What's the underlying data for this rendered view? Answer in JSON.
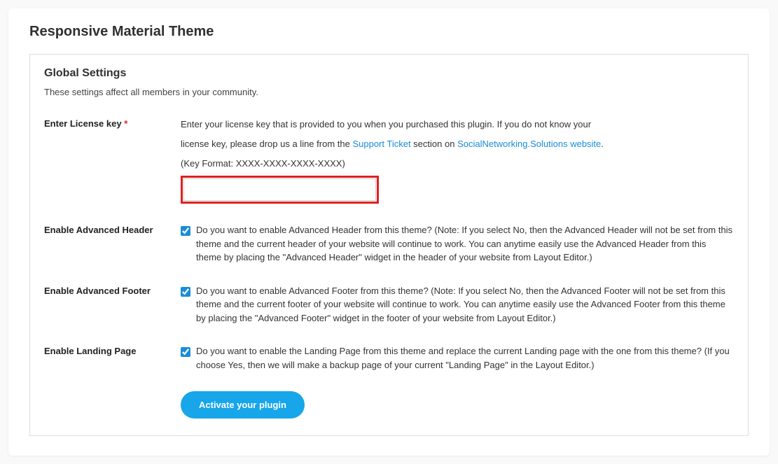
{
  "page_title": "Responsive Material Theme",
  "section": {
    "title": "Global Settings",
    "subtitle": "These settings affect all members in your community."
  },
  "license": {
    "label": "Enter License key",
    "required_mark": "*",
    "help_pre": "Enter your license key that is provided to you when you purchased this plugin. If you do not know your",
    "help_line2a": "license key, please drop us a line from the ",
    "help_link1": "Support Ticket",
    "help_line2b": " section on ",
    "help_link2": "SocialNetworking.Solutions website",
    "help_line2c": ".",
    "format": "(Key Format: XXXX-XXXX-XXXX-XXXX)",
    "value": ""
  },
  "adv_header": {
    "label": "Enable Advanced Header",
    "checked": true,
    "text": "Do you want to enable Advanced Header from this theme? (Note: If you select No, then the Advanced Header will not be set from this theme and the current header of your website will continue to work. You can anytime easily use the Advanced Header from this theme by placing the \"Advanced Header\" widget in the header of your website from Layout Editor.)"
  },
  "adv_footer": {
    "label": "Enable Advanced Footer",
    "checked": true,
    "text": "Do you want to enable Advanced Footer from this theme? (Note: If you select No, then the Advanced Footer will not be set from this theme and the current footer of your website will continue to work. You can anytime easily use the Advanced Footer from this theme by placing the \"Advanced Footer\" widget in the footer of your website from Layout Editor.)"
  },
  "landing": {
    "label": "Enable Landing Page",
    "checked": true,
    "text": "Do you want to enable the Landing Page from this theme and replace the current Landing page with the one from this theme? (If you choose Yes, then we will make a backup page of your current \"Landing Page\" in the Layout Editor.)"
  },
  "button": {
    "label": "Activate your plugin"
  }
}
